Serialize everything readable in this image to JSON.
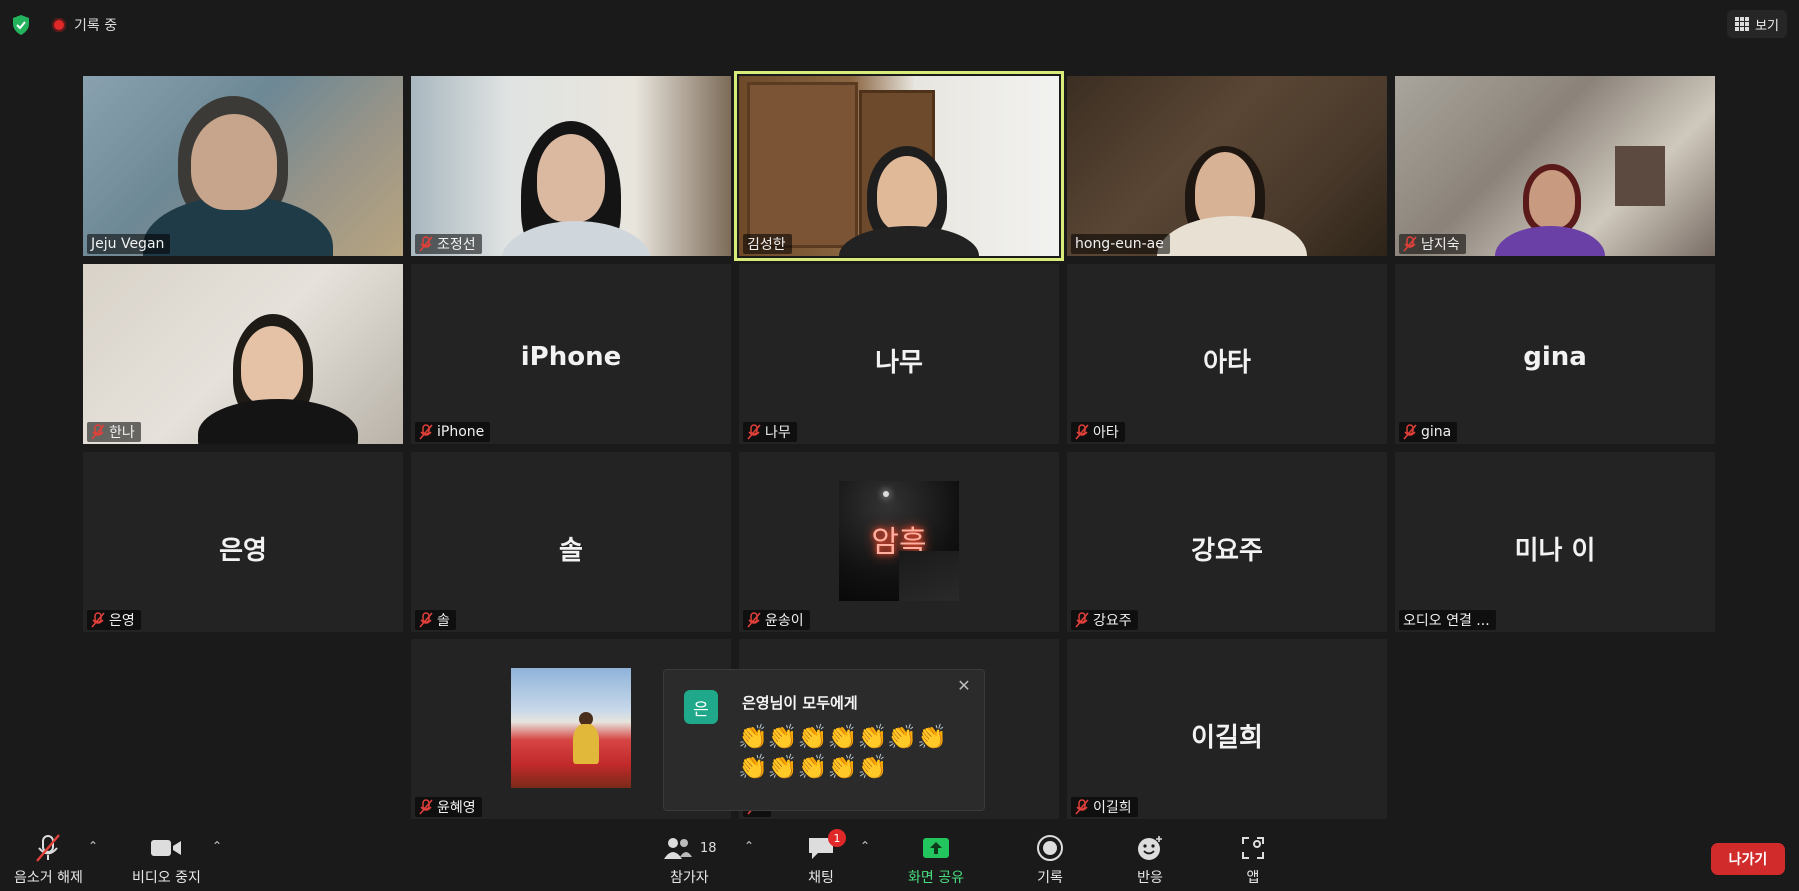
{
  "topbar": {
    "recording_label": "기록 중",
    "view_label": "보기"
  },
  "tiles": [
    {
      "name": "Jeju Vegan",
      "muted": false,
      "video": true
    },
    {
      "name": "조정선",
      "muted": true,
      "video": true
    },
    {
      "name": "김성한",
      "muted": false,
      "video": true,
      "active": true
    },
    {
      "name": "hong-eun-ae",
      "muted": false,
      "video": true
    },
    {
      "name": "남지숙",
      "muted": true,
      "video": true
    },
    {
      "name": "한나",
      "muted": true,
      "video": true
    },
    {
      "name": "iPhone",
      "display": "iPhone",
      "muted": true
    },
    {
      "name": "나무",
      "display": "나무",
      "muted": true
    },
    {
      "name": "아타",
      "display": "아타",
      "muted": true
    },
    {
      "name": "gina",
      "display": "gina",
      "muted": true
    },
    {
      "name": "은영",
      "display": "은영",
      "muted": true
    },
    {
      "name": "솔",
      "display": "솔",
      "muted": true
    },
    {
      "name": "윤송이",
      "muted": true,
      "thumb_text": "암흑"
    },
    {
      "name": "강요주",
      "display": "강요주",
      "muted": true
    },
    {
      "name": "미나 이",
      "display": "미나 이",
      "tag": "오디오 연결 ..."
    },
    {
      "name": "윤혜영",
      "muted": true
    },
    {
      "name": "",
      "muted": true
    },
    {
      "name": "이길희",
      "display": "이길희",
      "muted": true
    }
  ],
  "chat_popup": {
    "avatar_letter": "은",
    "title": "은영님이 모두에게",
    "message": "👏👏👏👏👏👏👏👏👏👏👏👏",
    "close": "✕"
  },
  "toolbar": {
    "audio_label": "음소거 해제",
    "video_label": "비디오 중지",
    "participants_label": "참가자",
    "participants_count": "18",
    "chat_label": "채팅",
    "chat_badge": "1",
    "share_label": "화면 공유",
    "record_label": "기록",
    "reactions_label": "반응",
    "apps_label": "앱",
    "leave_label": "나가기"
  },
  "colors": {
    "background": "#1a1a1a",
    "tile": "#232323",
    "active_border": "#d8ec7a",
    "share_green": "#22c55e",
    "leave_red": "#d12b2b",
    "mute_red": "#e0403a"
  }
}
